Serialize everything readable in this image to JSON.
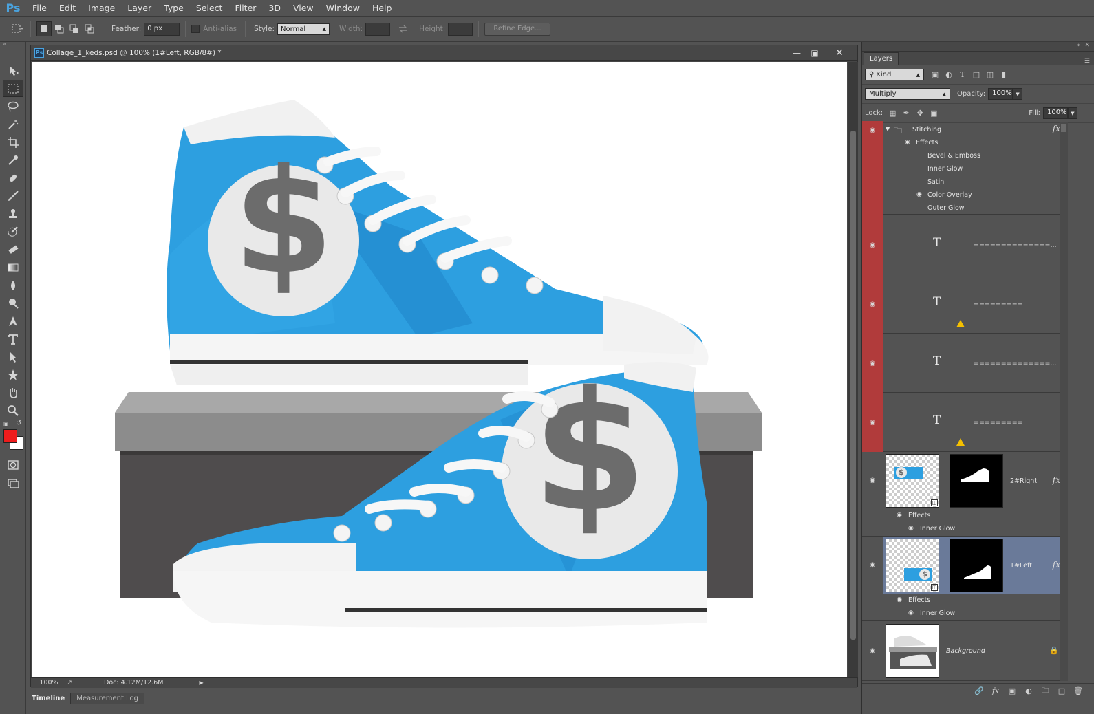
{
  "app": {
    "logo": "Ps"
  },
  "menu": [
    "File",
    "Edit",
    "Image",
    "Layer",
    "Type",
    "Select",
    "Filter",
    "3D",
    "View",
    "Window",
    "Help"
  ],
  "options": {
    "feather_label": "Feather:",
    "feather_value": "0 px",
    "antialias_label": "Anti-alias",
    "style_label": "Style:",
    "style_value": "Normal",
    "width_label": "Width:",
    "height_label": "Height:",
    "refine_label": "Refine Edge..."
  },
  "document": {
    "title": "Collage_1_keds.psd @ 100% (1#Left, RGB/8#) *",
    "zoom": "100%",
    "doc_info": "Doc: 4.12M/12.6M"
  },
  "bottom_tabs": [
    "Timeline",
    "Measurement Log"
  ],
  "layers_panel": {
    "tab": "Layers",
    "filter_kind": "Kind",
    "blend_mode": "Multiply",
    "opacity_label": "Opacity:",
    "opacity_value": "100%",
    "lock_label": "Lock:",
    "fill_label": "Fill:",
    "fill_value": "100%",
    "group": {
      "name": "Stitching",
      "effects_label": "Effects",
      "effects": [
        "Bevel & Emboss",
        "Inner Glow",
        "Satin",
        "Color Overlay",
        "Outer Glow"
      ]
    },
    "text_layers": [
      {
        "name": "==============...",
        "warning": false
      },
      {
        "name": "=========",
        "warning": true
      },
      {
        "name": "==============...",
        "warning": false
      },
      {
        "name": "=========",
        "warning": true
      }
    ],
    "right_layer": {
      "name": "2#Right",
      "effects_label": "Effects",
      "effect": "Inner Glow"
    },
    "left_layer": {
      "name": "1#Left",
      "effects_label": "Effects",
      "effect": "Inner Glow"
    },
    "background_layer": {
      "name": "Background"
    }
  },
  "colors": {
    "foreground": "#ee1c1c",
    "background": "#ffffff",
    "selected_layer": "#6a7a99",
    "red_group": "#b13b3b",
    "shoe_blue": "#2d9fe0"
  }
}
